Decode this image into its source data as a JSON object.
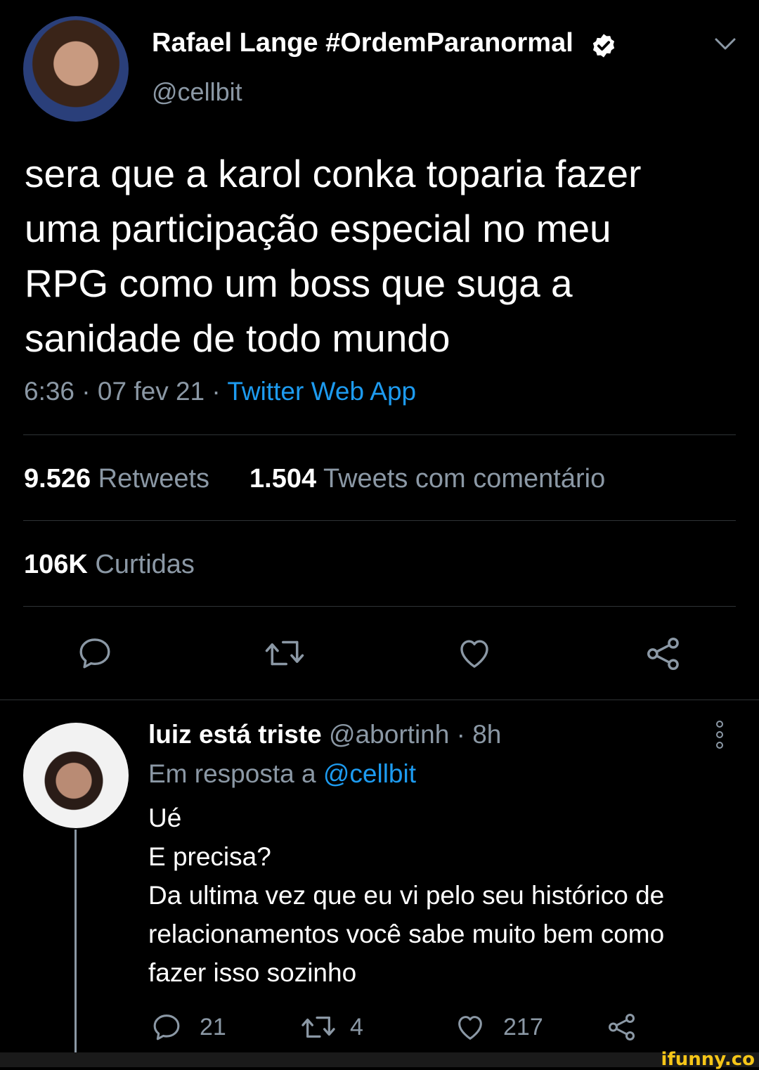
{
  "tweet": {
    "author_name": "Rafael Lange #OrdemParanormal",
    "author_handle": "@cellbit",
    "text_lines": [
      "sera que a karol conka toparia fazer",
      "uma participação especial no meu",
      "RPG como um boss que suga a",
      "sanidade de todo mundo"
    ],
    "time": "6:36",
    "date": "07 fev 21",
    "separator": "·",
    "source": "Twitter Web App",
    "retweets_count": "9.526",
    "retweets_label": "Retweets",
    "quotes_count": "1.504",
    "quotes_label": "Tweets com comentário",
    "likes_count": "106K",
    "likes_label": "Curtidas"
  },
  "reply": {
    "author_name": "luiz está triste",
    "author_handle": "@abortinh",
    "time_ago": "8h",
    "separator": "·",
    "in_reply_prefix": "Em resposta a",
    "in_reply_handle": "@cellbit",
    "text_lines": [
      "Ué",
      "E precisa?",
      "Da ultima vez que eu vi pelo seu histórico de",
      "relacionamentos você sabe muito bem como",
      "fazer isso sozinho"
    ],
    "reply_count": "21",
    "retweet_count": "4",
    "like_count": "217"
  },
  "watermark": "ifunny.co",
  "icons": [
    "verified-badge-icon",
    "chevron-down-icon",
    "reply-icon",
    "retweet-icon",
    "like-icon",
    "share-icon",
    "more-vertical-icon"
  ],
  "colors": {
    "background": "#000000",
    "link": "#1d9bf0",
    "muted": "#8b98a5",
    "divider": "#2f3336"
  }
}
